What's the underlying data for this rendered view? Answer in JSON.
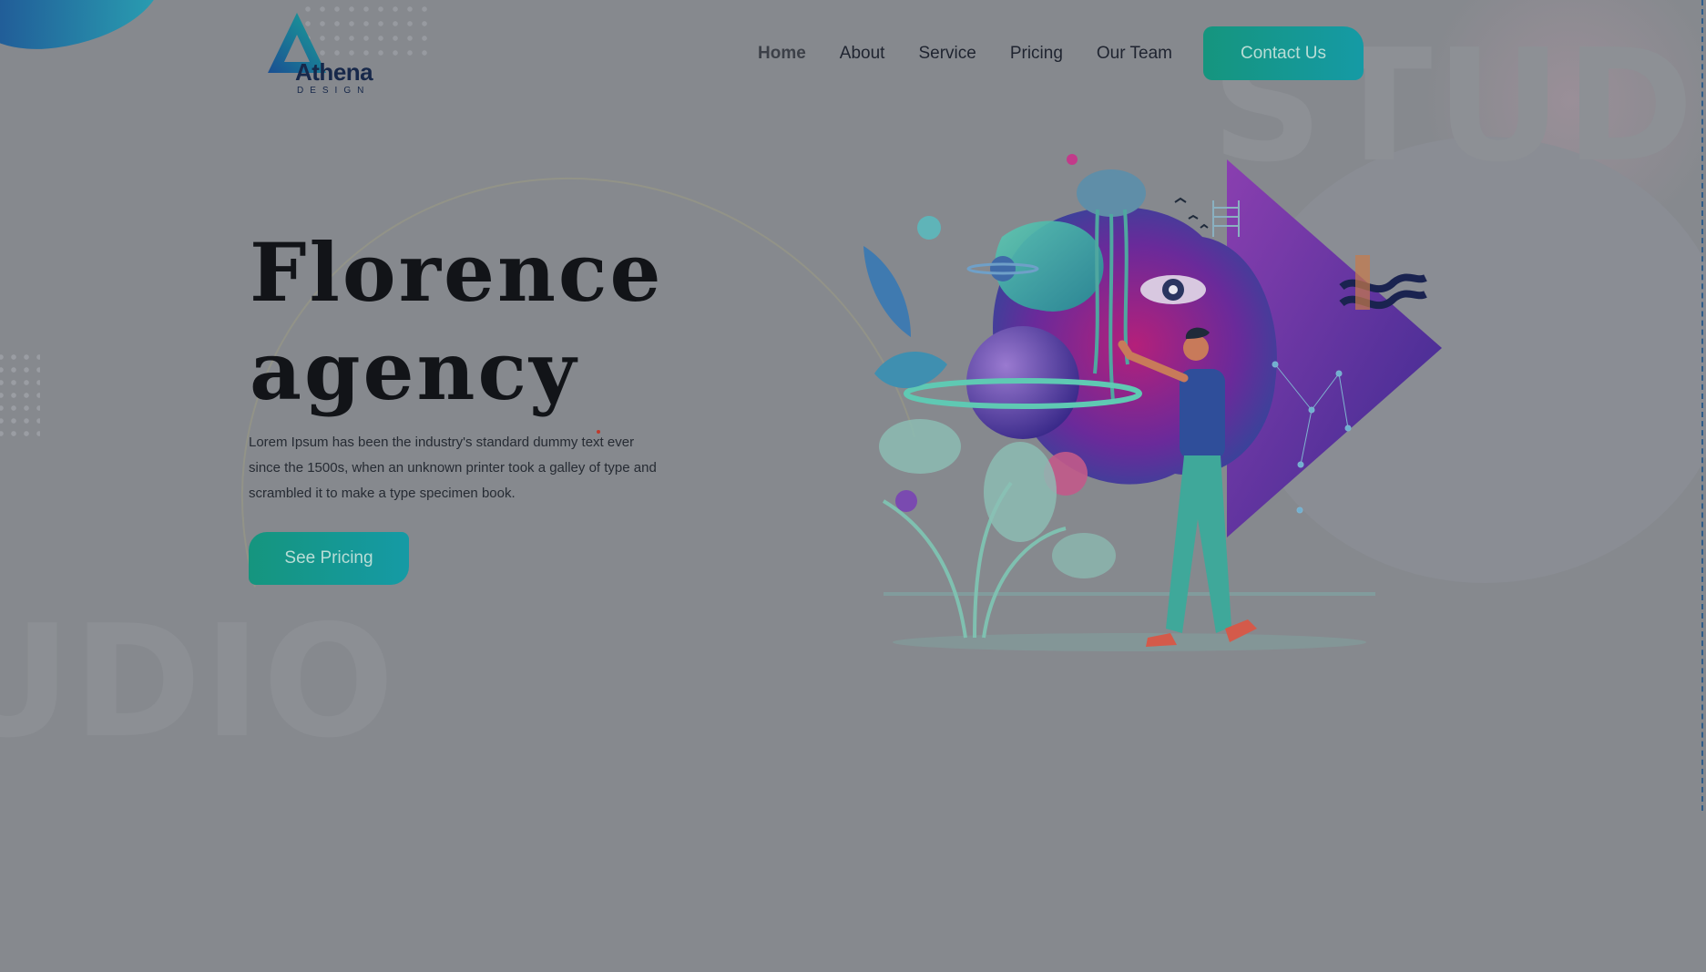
{
  "brand": {
    "name": "Athena",
    "tagline": "DESIGN"
  },
  "nav": {
    "items": [
      {
        "label": "Home",
        "active": true
      },
      {
        "label": "About"
      },
      {
        "label": "Service"
      },
      {
        "label": "Pricing"
      },
      {
        "label": "Our Team"
      }
    ],
    "cta": "Contact Us"
  },
  "hero": {
    "title_line1": "Florence",
    "title_line2": "agency",
    "description": "Lorem Ipsum has been the industry's standard dummy text ever since the 1500s, when an unknown printer took a galley of type and scrambled it to make a type specimen book.",
    "button": "See Pricing"
  },
  "decor": {
    "watermark_top": "STUDI",
    "watermark_bottom": "UDIO"
  },
  "colors": {
    "accent": "#15957e",
    "accent2": "#159aa5",
    "text_dark": "#121418",
    "overlay_bg": "#86898e"
  }
}
